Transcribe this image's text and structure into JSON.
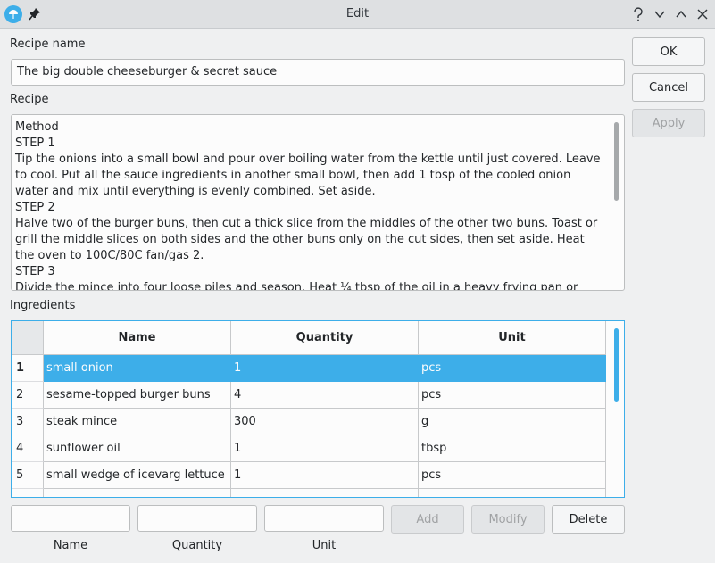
{
  "window": {
    "title": "Edit"
  },
  "buttons": {
    "ok": "OK",
    "cancel": "Cancel",
    "apply": "Apply",
    "add": "Add",
    "modify": "Modify",
    "delete": "Delete"
  },
  "recipe_name": {
    "label": "Recipe name",
    "value": "The big double cheeseburger & secret sauce"
  },
  "recipe": {
    "label": "Recipe",
    "lines": [
      "Method",
      "STEP 1",
      "Tip the onions into a small bowl and pour over boiling water from the kettle until just covered. Leave to cool. Put all the sauce ingredients in another small bowl, then add 1 tbsp of the cooled onion water and mix until everything is evenly combined. Set aside.",
      "STEP 2",
      "Halve two of the burger buns, then cut a thick slice from the middles of the other two buns. Toast or grill the middle slices on both sides and the other buns only on the cut sides, then set aside. Heat the oven to 100C/80C fan/gas 2.",
      "STEP 3",
      "Divide the mince into four loose piles and season. Heat ¼ tbsp of the oil in a heavy frying pan or skillet over"
    ]
  },
  "ingredients": {
    "label": "Ingredients",
    "columns": [
      "Name",
      "Quantity",
      "Unit"
    ],
    "rows": [
      {
        "num": "1",
        "name": "small onion",
        "quantity": "1",
        "unit": "pcs"
      },
      {
        "num": "2",
        "name": "sesame-topped burger buns",
        "quantity": "4",
        "unit": "pcs"
      },
      {
        "num": "3",
        "name": "steak mince",
        "quantity": "300",
        "unit": "g"
      },
      {
        "num": "4",
        "name": "sunflower oil",
        "quantity": "1",
        "unit": "tbsp"
      },
      {
        "num": "5",
        "name": "small wedge of icevarg lettuce",
        "quantity": "1",
        "unit": "pcs"
      }
    ],
    "selected_row": 0
  },
  "add_fields": {
    "name_label": "Name",
    "quantity_label": "Quantity",
    "unit_label": "Unit",
    "name_value": "",
    "quantity_value": "",
    "unit_value": ""
  },
  "colors": {
    "accent": "#3daee9",
    "background": "#eff0f1",
    "titlebar": "#dee0e2"
  },
  "icons": [
    "app-icon",
    "pin-icon",
    "help-icon",
    "minimize-icon",
    "maximize-icon"
  ]
}
